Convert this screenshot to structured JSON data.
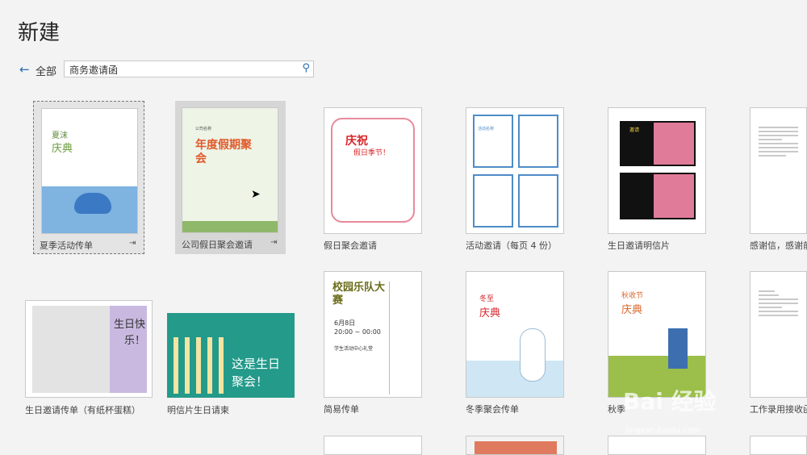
{
  "page": {
    "title": "新建"
  },
  "nav": {
    "back_label": "←",
    "all_label": "全部"
  },
  "search": {
    "value": "商务邀请函",
    "icon": "search-icon"
  },
  "templates_row1": [
    {
      "label": "夏季活动传单",
      "thumb_title": "夏沫",
      "thumb_sub": "庆典"
    },
    {
      "label": "公司假日聚会邀请",
      "thumb_title": "年度假期聚会",
      "thumb_sub": "公司名称"
    },
    {
      "label": "假日聚会邀请",
      "thumb_title": "庆祝",
      "thumb_sub": "假日季节！"
    },
    {
      "label": "活动邀请（每页 4 份）",
      "thumb_title": "活动名称"
    },
    {
      "label": "生日邀请明信片",
      "thumb_title": "邀请"
    },
    {
      "label": "感谢信，感谢前任"
    }
  ],
  "templates_row2": [
    {
      "label": "生日邀请传单（有纸杯蛋糕）",
      "thumb_title": "生日快乐！"
    },
    {
      "label": "明信片生日请柬",
      "thumb_title": "这是生日聚会！"
    },
    {
      "label": "简易传单",
      "thumb_title": "校园乐队大赛",
      "thumb_date": "6月8日",
      "thumb_time": "20:00 ~ 00:00",
      "thumb_place": "学生活动中心礼堂"
    },
    {
      "label": "冬季聚会传单",
      "thumb_title": "冬至",
      "thumb_sub": "庆典"
    },
    {
      "label": "秋季",
      "thumb_title": "秋收节",
      "thumb_sub": "庆典"
    },
    {
      "label": "工作录用接收函"
    }
  ],
  "watermark": {
    "brand": "Bai 经验",
    "url": "jingyan.baidu.com"
  },
  "colors": {
    "accent": "#2b6cb0",
    "selected_tile": "#d6d6d6"
  }
}
